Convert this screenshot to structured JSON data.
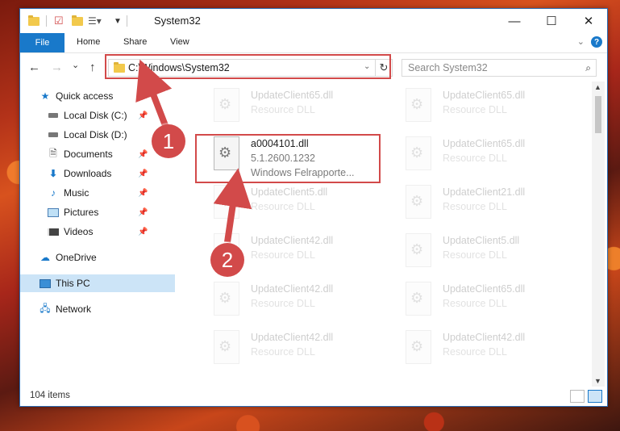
{
  "window": {
    "title": "System32",
    "controls": {
      "minimize": "—",
      "maximize": "☐",
      "close": "✕"
    }
  },
  "ribbon": {
    "tabs": [
      {
        "label": "File"
      },
      {
        "label": "Home"
      },
      {
        "label": "Share"
      },
      {
        "label": "View"
      }
    ],
    "help": "?"
  },
  "nav": {
    "back": "←",
    "forward": "→",
    "recent": "⌄",
    "up": "↑",
    "address": "C:\\Windows\\System32",
    "search_placeholder": "Search System32"
  },
  "sidebar": {
    "items": [
      {
        "label": "Quick access",
        "icon": "star-icon"
      },
      {
        "label": "Local Disk (C:)",
        "icon": "drive-icon",
        "pinned": true
      },
      {
        "label": "Local Disk (D:)",
        "icon": "drive-icon",
        "pinned": false
      },
      {
        "label": "Documents",
        "icon": "documents-icon",
        "pinned": true
      },
      {
        "label": "Downloads",
        "icon": "download-icon",
        "pinned": true
      },
      {
        "label": "Music",
        "icon": "music-icon",
        "pinned": true
      },
      {
        "label": "Pictures",
        "icon": "pictures-icon",
        "pinned": true
      },
      {
        "label": "Videos",
        "icon": "videos-icon",
        "pinned": true
      },
      {
        "label": "OneDrive",
        "icon": "cloud-icon"
      },
      {
        "label": "This PC",
        "icon": "computer-icon",
        "selected": true
      },
      {
        "label": "Network",
        "icon": "network-icon"
      }
    ]
  },
  "files": {
    "highlighted": {
      "name": "a0004101.dll",
      "version": "5.1.2600.1232",
      "description": "Windows Felrapporte..."
    },
    "others": [
      {
        "name": "UpdateClient65.dll",
        "type": "Resource DLL"
      },
      {
        "name": "UpdateClient65.dll",
        "type": "Resource DLL"
      },
      {
        "name": "UpdateClient65.dll",
        "type": "Resource DLL"
      },
      {
        "name": "UpdateClient5.dll",
        "type": "Resource DLL"
      },
      {
        "name": "UpdateClient21.dll",
        "type": "Resource DLL"
      },
      {
        "name": "UpdateClient42.dll",
        "type": "Resource DLL"
      },
      {
        "name": "UpdateClient5.dll",
        "type": "Resource DLL"
      },
      {
        "name": "UpdateClient42.dll",
        "type": "Resource DLL"
      },
      {
        "name": "UpdateClient65.dll",
        "type": "Resource DLL"
      },
      {
        "name": "UpdateClient42.dll",
        "type": "Resource DLL"
      },
      {
        "name": "UpdateClient42.dll",
        "type": "Resource DLL"
      }
    ]
  },
  "status": {
    "item_count": "104 items"
  },
  "callouts": [
    {
      "label": "1"
    },
    {
      "label": "2"
    }
  ],
  "colors": {
    "accent": "#1979ca",
    "callout": "#d24a4a",
    "selection": "#cce4f7"
  }
}
